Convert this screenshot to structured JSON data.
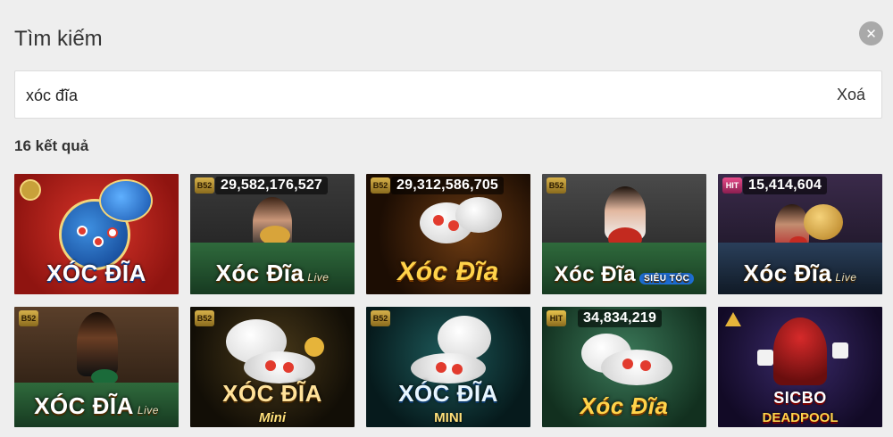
{
  "header": {
    "title": "Tìm kiếm"
  },
  "search": {
    "value": "xóc đĩa",
    "clear_label": "Xoá"
  },
  "results": {
    "count_label": "16 kết quả",
    "items": [
      {
        "name": "XÓC ĐĨA",
        "badge": "XCLUB",
        "jackpot": "",
        "tag": "",
        "icon": "xoc-dia-bowl-icon"
      },
      {
        "name": "Xóc Đĩa",
        "badge": "B52",
        "jackpot": "29,582,176,527",
        "tag": "Live",
        "icon": "live-dealer-icon"
      },
      {
        "name": "Xóc Đĩa",
        "badge": "B52",
        "jackpot": "29,312,586,705",
        "tag": "",
        "icon": "xoc-dia-bowl-icon"
      },
      {
        "name": "Xóc Đĩa",
        "badge": "B52",
        "jackpot": "",
        "tag": "SIÊU TỐC",
        "icon": "live-dealer-icon"
      },
      {
        "name": "Xóc Đĩa",
        "badge": "HIT",
        "jackpot": "15,414,604",
        "tag": "Live",
        "icon": "live-dealer-icon"
      },
      {
        "name": "XÓC ĐĨA",
        "badge": "B52",
        "jackpot": "",
        "tag": "Live",
        "icon": "live-dealer-icon"
      },
      {
        "name": "XÓC ĐĨA",
        "badge": "B52",
        "jackpot": "",
        "tag": "",
        "sub": "Mini",
        "icon": "xoc-dia-bowl-icon"
      },
      {
        "name": "XÓC ĐĨA",
        "badge": "B52",
        "jackpot": "",
        "tag": "",
        "sub": "MINI",
        "icon": "xoc-dia-bowl-icon"
      },
      {
        "name": "Xóc Đĩa",
        "badge": "HIT",
        "jackpot": "34,834,219",
        "tag": "",
        "icon": "xoc-dia-bowl-icon"
      },
      {
        "name": "SICBO",
        "badge": "",
        "jackpot": "",
        "tag": "",
        "sub": "DEADPOOL",
        "icon": "deadpool-icon"
      }
    ]
  },
  "colors": {
    "background": "#eeeeee",
    "close_button": "#a9a9a9",
    "search_box": "#ffffff"
  }
}
